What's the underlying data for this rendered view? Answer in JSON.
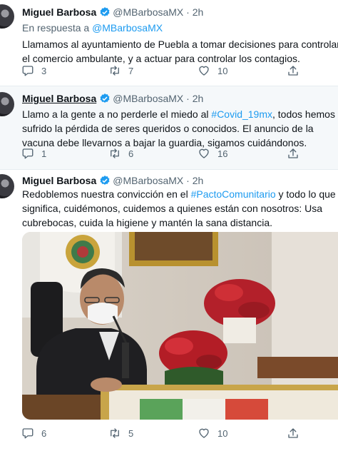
{
  "tweets": [
    {
      "author": "Miguel Barbosa",
      "handle": "@MBarbosaMX",
      "separator": "·",
      "time": "2h",
      "reply_prefix": "En respuesta a",
      "reply_to": "@MBarbosaMX",
      "text": "Llamamos al ayuntamiento de Puebla a tomar decisiones para controlar el comercio ambulante, y a actuar para controlar los contagios.",
      "replies": "3",
      "retweets": "7",
      "likes": "10"
    },
    {
      "author": "Miguel Barbosa",
      "handle": "@MBarbosaMX",
      "separator": "·",
      "time": "2h",
      "text_before": "Llamo a la gente a no perderle el miedo al ",
      "hashtag": "#Covid_19mx",
      "text_after": ", todos hemos sufrido la pérdida de seres queridos o conocidos. El anuncio de la vacuna debe llevarnos a bajar la guardia, sigamos cuidándonos.",
      "replies": "1",
      "retweets": "6",
      "likes": "16"
    },
    {
      "author": "Miguel Barbosa",
      "handle": "@MBarbosaMX",
      "separator": "·",
      "time": "2h",
      "text_before": "Redoblemos nuestra convicción en el ",
      "hashtag": "#PactoComunitario",
      "text_after": " y todo lo que significa, cuidémonos, cuidemos a quienes están con nosotros: Usa cubrebocas, cuida la higiene y mantén la sana distancia.",
      "replies": "6",
      "retweets": "5",
      "likes": "10"
    }
  ],
  "icons": {
    "reply": "reply-icon",
    "retweet": "retweet-icon",
    "like": "heart-icon",
    "share": "share-icon",
    "verified": "verified-badge-icon"
  },
  "colors": {
    "link": "#1d9bf0",
    "secondary_text": "#536471",
    "highlight_bg": "#f5f8fa"
  }
}
